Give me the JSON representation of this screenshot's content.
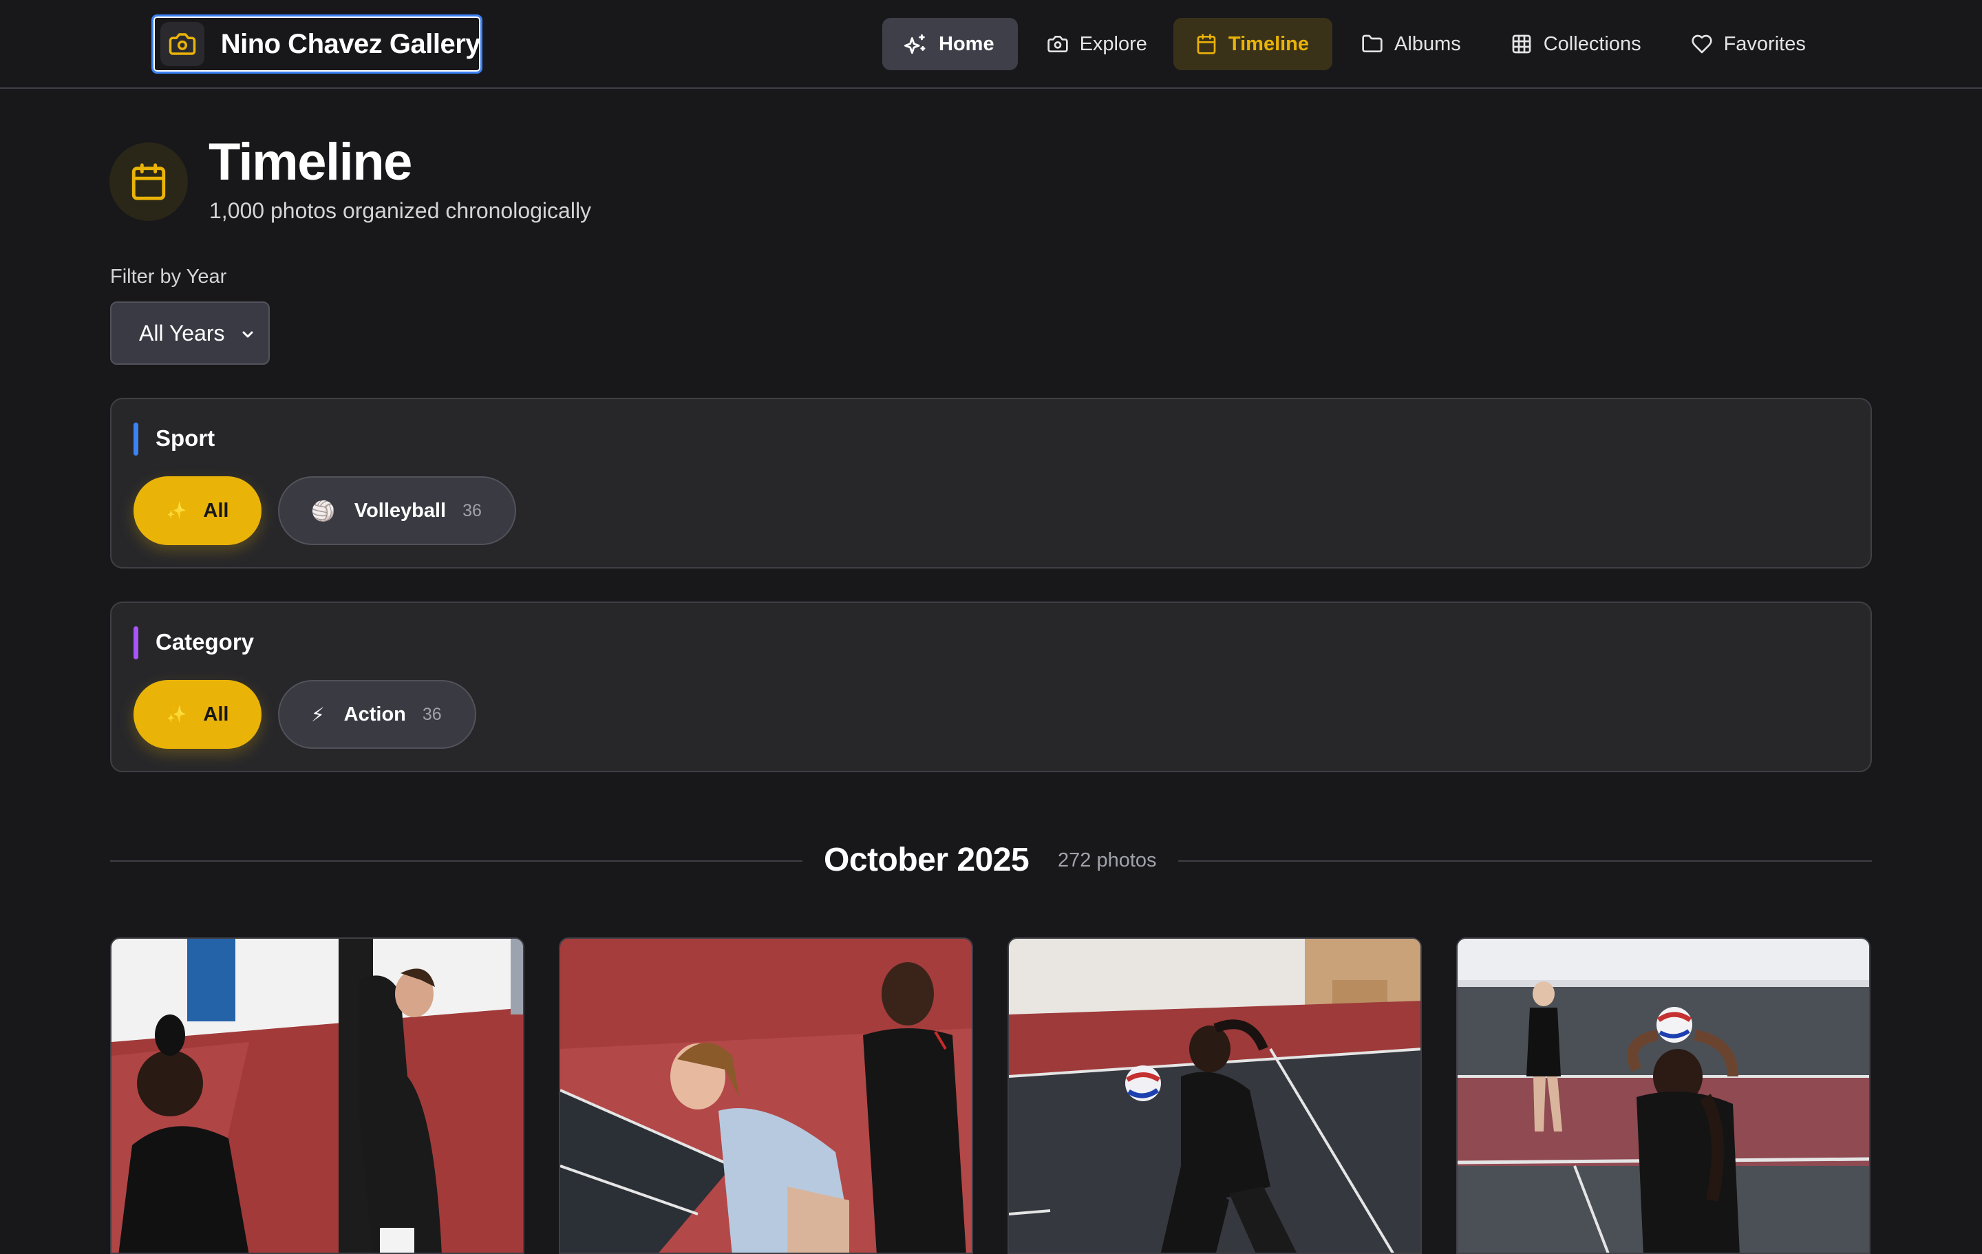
{
  "brand": {
    "name": "Nino Chavez Gallery",
    "icon": "camera-icon"
  },
  "nav": {
    "items": [
      {
        "label": "Home",
        "icon": "sparkles-icon"
      },
      {
        "label": "Explore",
        "icon": "camera-icon"
      },
      {
        "label": "Timeline",
        "icon": "calendar-icon"
      },
      {
        "label": "Albums",
        "icon": "folder-icon"
      },
      {
        "label": "Collections",
        "icon": "grid-icon"
      },
      {
        "label": "Favorites",
        "icon": "heart-icon"
      }
    ],
    "active": "Timeline"
  },
  "header": {
    "icon": "calendar-icon",
    "title": "Timeline",
    "subtitle": "1,000 photos organized chronologically"
  },
  "filter": {
    "label": "Filter by Year",
    "selected": "All Years"
  },
  "sport": {
    "title": "Sport",
    "accent": "#3b82f6",
    "all": {
      "emoji": "✨",
      "label": "All"
    },
    "options": [
      {
        "emoji": "🏐",
        "label": "Volleyball",
        "count": "36"
      }
    ]
  },
  "category": {
    "title": "Category",
    "accent": "#a855f7",
    "all": {
      "emoji": "✨",
      "label": "All"
    },
    "options": [
      {
        "emoji": "⚡",
        "label": "Action",
        "count": "36"
      }
    ]
  },
  "timeline": {
    "groups": [
      {
        "month": "October 2025",
        "count": "272 photos"
      }
    ]
  },
  "colors": {
    "background": "#18181b",
    "accent": "#eab308",
    "panel": "#27272a"
  }
}
